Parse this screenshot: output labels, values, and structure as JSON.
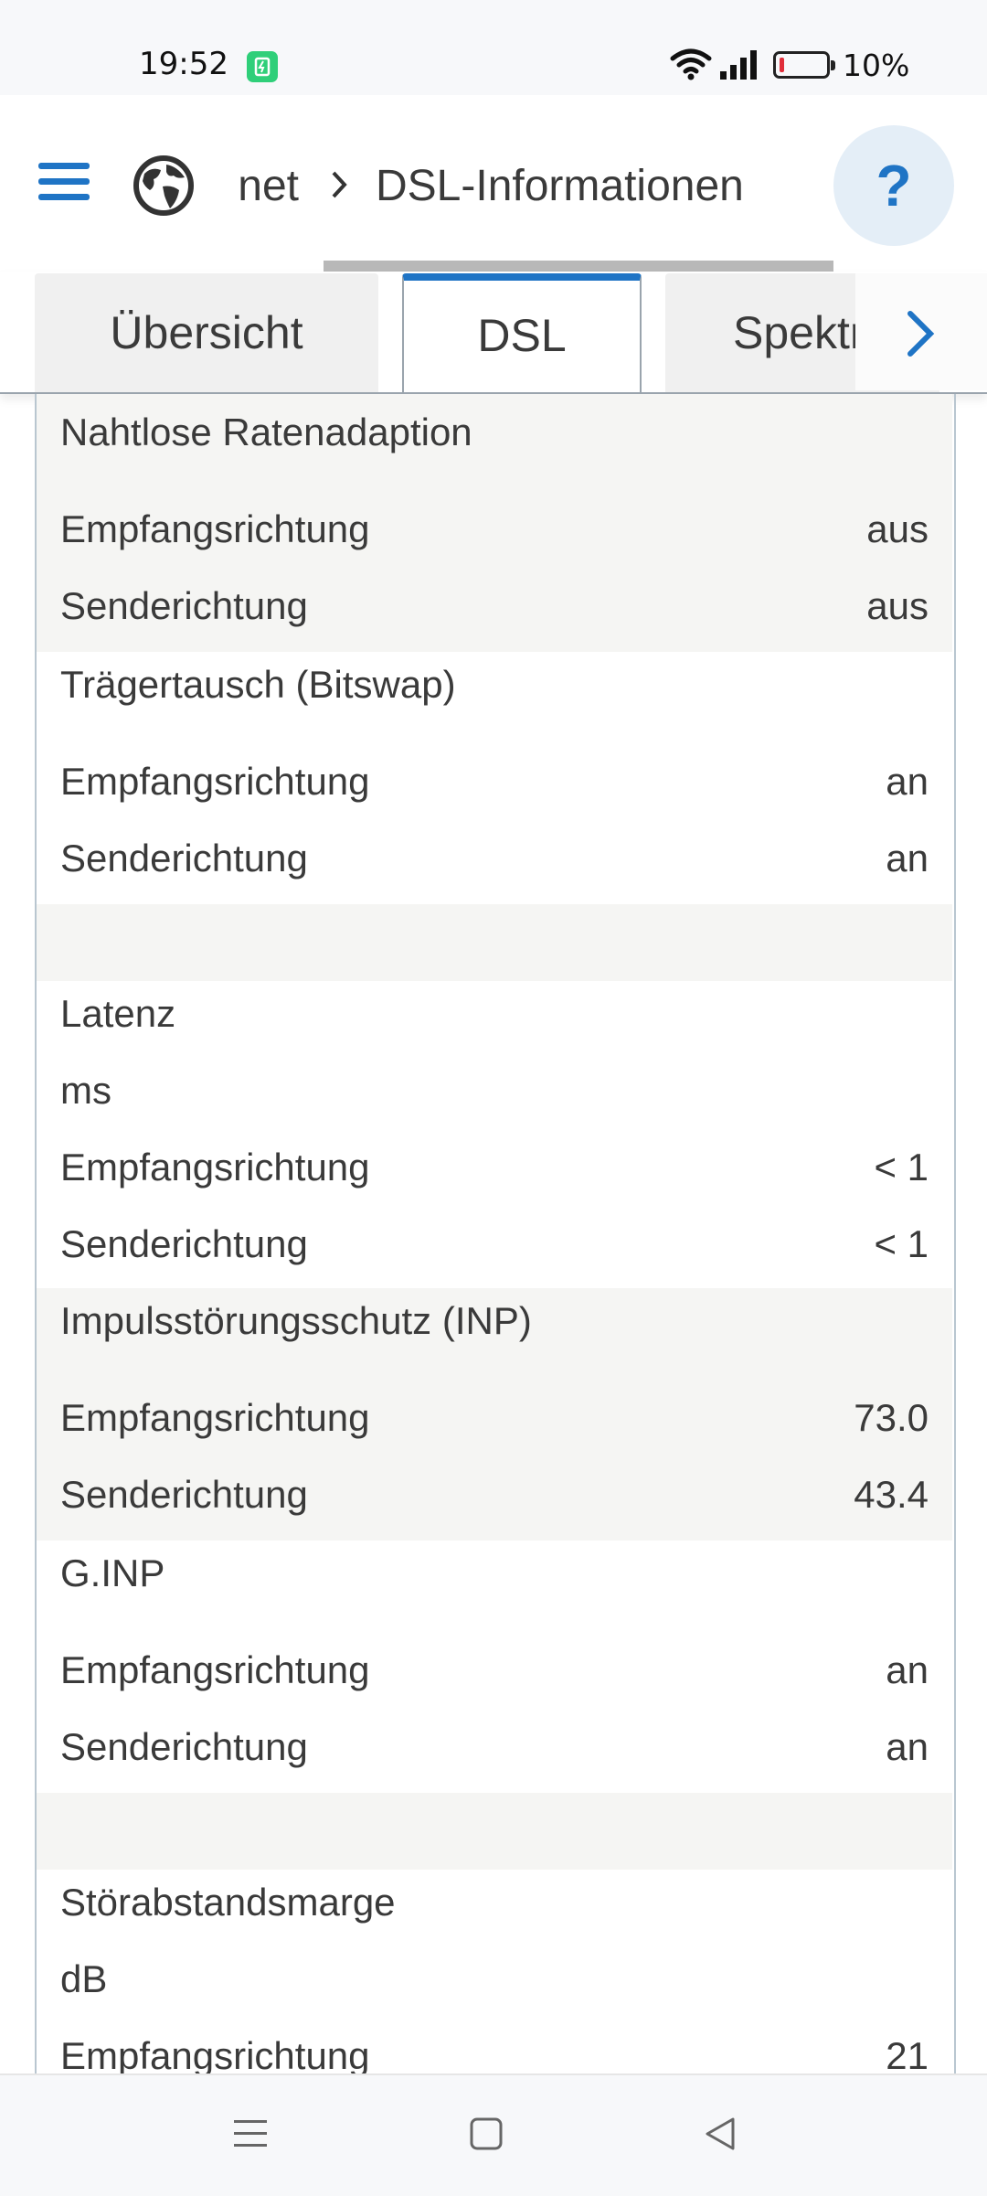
{
  "status_bar": {
    "time": "19:52",
    "battery_text": "10%",
    "battery_level_percent": 10,
    "battery_color": "#e02e3a",
    "charging_color": "#2fcf79"
  },
  "header": {
    "menu_icon": "hamburger-menu-icon",
    "globe_icon": "globe-icon",
    "breadcrumb_parent": "Internet",
    "breadcrumb_separator": "chevron-right-icon",
    "breadcrumb_current": "DSL-Informationen",
    "help_label": "?",
    "accent_color": "#1f74c5"
  },
  "tabs": [
    {
      "label": "Übersicht",
      "active": false
    },
    {
      "label": "DSL",
      "active": true
    },
    {
      "label": "Spektrum",
      "active": false
    }
  ],
  "sections": {
    "seamless": {
      "title": "Nahtlose Ratenadaption",
      "rows": [
        {
          "label": "Empfangsrichtung",
          "value": "aus"
        },
        {
          "label": "Senderichtung",
          "value": "aus"
        }
      ]
    },
    "bitswap": {
      "title": "Trägertausch (Bitswap)",
      "rows": [
        {
          "label": "Empfangsrichtung",
          "value": "an"
        },
        {
          "label": "Senderichtung",
          "value": "an"
        }
      ]
    },
    "latency": {
      "title": "Latenz",
      "unit": "ms",
      "rows": [
        {
          "label": "Empfangsrichtung",
          "value": "< 1"
        },
        {
          "label": "Senderichtung",
          "value": "< 1"
        }
      ]
    },
    "inp": {
      "title": "Impulsstörungsschutz (INP)",
      "rows": [
        {
          "label": "Empfangsrichtung",
          "value": "73.0"
        },
        {
          "label": "Senderichtung",
          "value": "43.4"
        }
      ]
    },
    "ginp": {
      "title": "G.INP",
      "rows": [
        {
          "label": "Empfangsrichtung",
          "value": "an"
        },
        {
          "label": "Senderichtung",
          "value": "an"
        }
      ]
    },
    "snr": {
      "title": "Störabstandsmarge",
      "unit": "dB",
      "rows": [
        {
          "label": "Empfangsrichtung",
          "value": "21"
        }
      ]
    }
  },
  "navbar": {
    "menu_icon": "recent-apps-icon",
    "home_icon": "home-icon",
    "back_icon": "back-icon"
  }
}
